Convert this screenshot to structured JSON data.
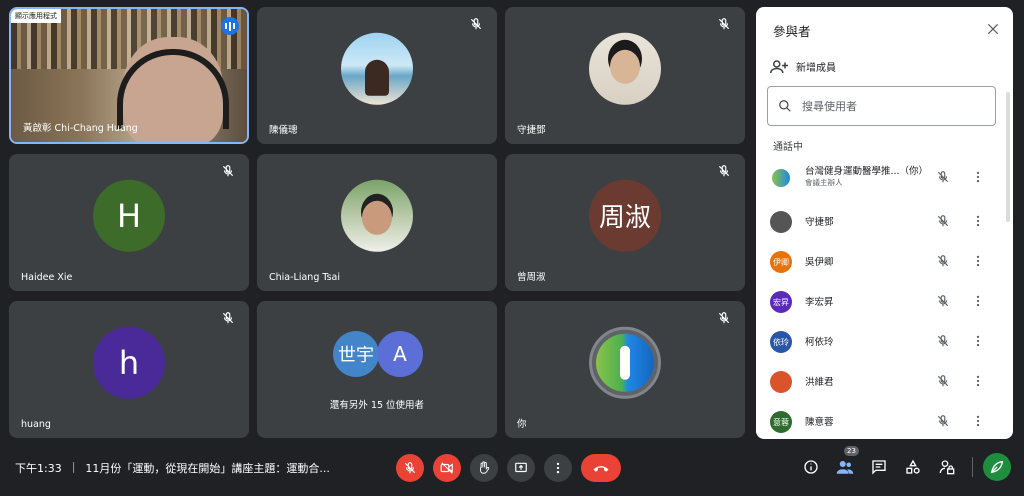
{
  "tiles": [
    {
      "name": "黃啟彰 Chi-Chang Huang",
      "badge": "顯示應用程式",
      "avatar": "video",
      "muted": false
    },
    {
      "name": "陳儀璁",
      "avatar": "photo",
      "muted": true
    },
    {
      "name": "守捷鄧",
      "avatar": "photo",
      "muted": true
    },
    {
      "name": "Haidee Xie",
      "avatar": "H",
      "color": "#3d6b2a",
      "muted": true
    },
    {
      "name": "Chia-Liang Tsai",
      "avatar": "photo",
      "muted": false
    },
    {
      "name": "曾周淑",
      "avatar": "周淑",
      "color": "#6b3b31",
      "muted": true
    },
    {
      "name": "huang",
      "avatar": "h",
      "color": "#4a2a99",
      "muted": true
    },
    {
      "name": "還有另外 15 位使用者",
      "avatars": [
        "世宇",
        "A"
      ],
      "colors": [
        "#4285c9",
        "#5b6fd6"
      ],
      "muted": false
    },
    {
      "name": "你",
      "avatar": "logo",
      "muted": true
    }
  ],
  "panel": {
    "title": "參與者",
    "add_label": "新增成員",
    "search_placeholder": "搜尋使用者",
    "section": "通話中",
    "participants": [
      {
        "name": "台灣健身運動醫學推...（你）",
        "sub": "會議主辦人",
        "initials": "",
        "color": "#ffffff"
      },
      {
        "name": "守捷鄧",
        "initials": "",
        "color": "#555"
      },
      {
        "name": "吳伊卿",
        "initials": "伊卿",
        "color": "#e8710a"
      },
      {
        "name": "李宏昇",
        "initials": "宏昇",
        "color": "#5b2ab8"
      },
      {
        "name": "柯依玲",
        "initials": "依玲",
        "color": "#2a56a8"
      },
      {
        "name": "洪維君",
        "initials": "",
        "color": "#d9542b"
      },
      {
        "name": "陳意蓉",
        "initials": "意蓉",
        "color": "#2e6b2e"
      }
    ]
  },
  "bottom": {
    "time": "下午1:33",
    "title": "11月份「運動，從現在開始」講座主題：運動合...",
    "participant_count": "23"
  },
  "colors": {
    "danger": "#ea4335",
    "accent": "#8ab4f8",
    "active": "#1e8e3e"
  }
}
